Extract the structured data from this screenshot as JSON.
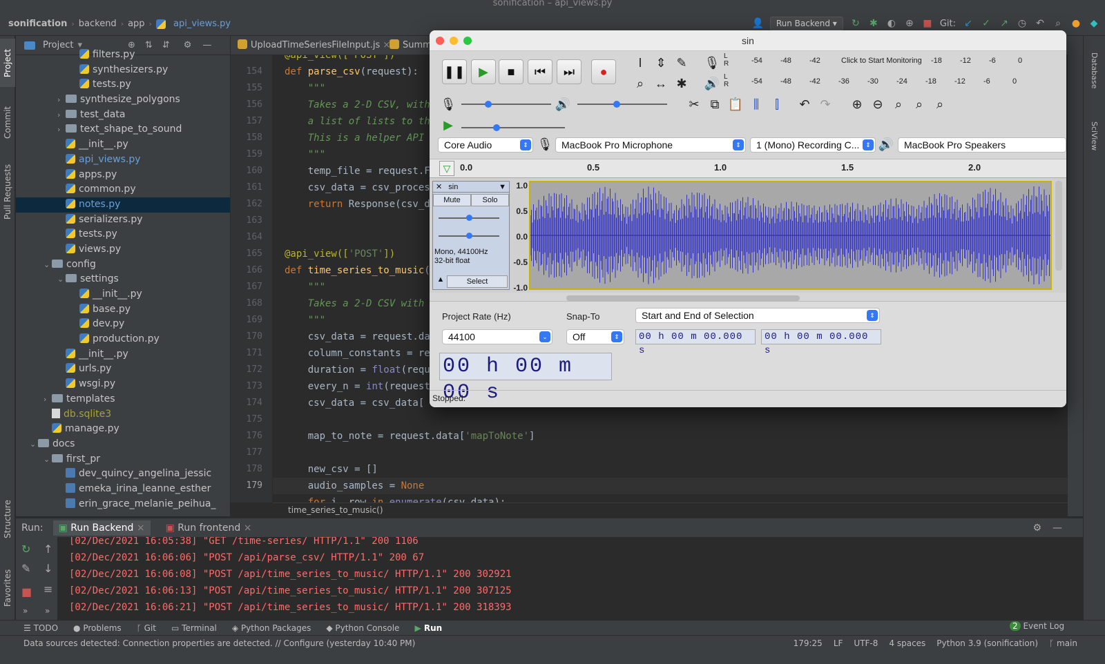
{
  "window_title": "sonification – api_views.py",
  "breadcrumb": {
    "project": "sonification",
    "p1": "backend",
    "p2": "app",
    "file": "api_views.py"
  },
  "toolbar": {
    "run_config": "Run Backend",
    "git_label": "Git:"
  },
  "left_tabs": {
    "project": "Project",
    "commit": "Commit",
    "pull_requests": "Pull Requests",
    "structure": "Structure",
    "favorites": "Favorites"
  },
  "right_tabs": {
    "database": "Database",
    "sciview": "SciView"
  },
  "project_panel": {
    "title": "Project",
    "rows": [
      {
        "indent": 4,
        "type": "py",
        "label": "filters.py"
      },
      {
        "indent": 4,
        "type": "py",
        "label": "synthesizers.py"
      },
      {
        "indent": 4,
        "type": "py",
        "label": "tests.py"
      },
      {
        "indent": 3,
        "type": "folder",
        "arrow": "›",
        "label": "synthesize_polygons"
      },
      {
        "indent": 3,
        "type": "folder",
        "arrow": "›",
        "label": "test_data"
      },
      {
        "indent": 3,
        "type": "folder",
        "arrow": "›",
        "label": "text_shape_to_sound"
      },
      {
        "indent": 3,
        "type": "py",
        "label": "__init__.py"
      },
      {
        "indent": 3,
        "type": "py",
        "label": "api_views.py",
        "color": "#6a9fd8"
      },
      {
        "indent": 3,
        "type": "py",
        "label": "apps.py"
      },
      {
        "indent": 3,
        "type": "py",
        "label": "common.py"
      },
      {
        "indent": 3,
        "type": "py",
        "label": "notes.py",
        "color": "#6a9fd8",
        "selected": true
      },
      {
        "indent": 3,
        "type": "py",
        "label": "serializers.py"
      },
      {
        "indent": 3,
        "type": "py",
        "label": "tests.py"
      },
      {
        "indent": 3,
        "type": "py",
        "label": "views.py"
      },
      {
        "indent": 2,
        "type": "folder",
        "arrow": "⌄",
        "label": "config"
      },
      {
        "indent": 3,
        "type": "folder",
        "arrow": "⌄",
        "label": "settings"
      },
      {
        "indent": 4,
        "type": "py",
        "label": "__init__.py"
      },
      {
        "indent": 4,
        "type": "py",
        "label": "base.py"
      },
      {
        "indent": 4,
        "type": "py",
        "label": "dev.py"
      },
      {
        "indent": 4,
        "type": "py",
        "label": "production.py"
      },
      {
        "indent": 3,
        "type": "py",
        "label": "__init__.py"
      },
      {
        "indent": 3,
        "type": "py",
        "label": "urls.py"
      },
      {
        "indent": 3,
        "type": "py",
        "label": "wsgi.py"
      },
      {
        "indent": 2,
        "type": "folder",
        "arrow": "›",
        "label": "templates"
      },
      {
        "indent": 2,
        "type": "db",
        "label": "db.sqlite3",
        "color": "#a5a23a"
      },
      {
        "indent": 2,
        "type": "py",
        "label": "manage.py"
      },
      {
        "indent": 1,
        "type": "folder",
        "arrow": "⌄",
        "label": "docs"
      },
      {
        "indent": 2,
        "type": "folder",
        "arrow": "⌄",
        "label": "first_pr"
      },
      {
        "indent": 3,
        "type": "md",
        "label": "dev_quincy_angelina_jessic"
      },
      {
        "indent": 3,
        "type": "md",
        "label": "emeka_irina_leanne_esther"
      },
      {
        "indent": 3,
        "type": "md",
        "label": "erin_grace_melanie_peihua_"
      }
    ]
  },
  "editor": {
    "tabs": [
      "UploadTimeSeriesFileInput.js",
      "Summ"
    ],
    "line_numbers": [
      "",
      "154",
      "155",
      "156",
      "157",
      "158",
      "159",
      "160",
      "161",
      "162",
      "163",
      "164",
      "165",
      "166",
      "167",
      "168",
      "169",
      "170",
      "171",
      "172",
      "173",
      "174",
      "175",
      "176",
      "177",
      "178",
      "179",
      ""
    ],
    "current_line": "179",
    "code_lines": [
      [
        [
          "dec",
          "@api_view(['POST'])"
        ]
      ],
      [
        [
          "kw",
          "def "
        ],
        [
          "fn",
          "parse_csv"
        ],
        [
          "",
          "(request):"
        ]
      ],
      [
        [
          "doc",
          "    \"\"\""
        ]
      ],
      [
        [
          "doc",
          "    Takes a 2-D CSV, with"
        ]
      ],
      [
        [
          "doc",
          "    a list of lists to th"
        ]
      ],
      [
        [
          "doc",
          "    This is a helper API"
        ]
      ],
      [
        [
          "doc",
          "    \"\"\""
        ]
      ],
      [
        [
          "",
          "    temp_file = request.F"
        ]
      ],
      [
        [
          "",
          "    csv_data = csv_proces"
        ]
      ],
      [
        [
          "kw",
          "    return "
        ],
        [
          "",
          "Response(csv_d"
        ]
      ],
      [
        [
          "",
          ""
        ]
      ],
      [
        [
          "",
          ""
        ]
      ],
      [
        [
          "dec",
          "@api_view(["
        ],
        [
          "str",
          "'POST'"
        ],
        [
          "dec",
          "])"
        ]
      ],
      [
        [
          "kw",
          "def "
        ],
        [
          "fn",
          "time_series_to_music"
        ],
        [
          "",
          "("
        ]
      ],
      [
        [
          "doc",
          "    \"\"\""
        ]
      ],
      [
        [
          "doc",
          "    Takes a 2-D CSV with"
        ]
      ],
      [
        [
          "doc",
          "    \"\"\""
        ]
      ],
      [
        [
          "",
          "    csv_data = request.da"
        ]
      ],
      [
        [
          "",
          "    column_constants = re"
        ]
      ],
      [
        [
          "",
          "    duration = "
        ],
        [
          "bi",
          "float"
        ],
        [
          "",
          "(requ"
        ]
      ],
      [
        [
          "",
          "    every_n = "
        ],
        [
          "bi",
          "int"
        ],
        [
          "",
          "(request"
        ]
      ],
      [
        [
          "",
          "    csv_data = csv_data["
        ]
      ],
      [
        [
          "",
          ""
        ]
      ],
      [
        [
          "",
          "    map_to_note = request.data["
        ],
        [
          "str",
          "'mapToNote'"
        ],
        [
          "",
          "]"
        ]
      ],
      [
        [
          "",
          ""
        ]
      ],
      [
        [
          "",
          "    new_csv = []"
        ]
      ],
      [
        [
          "",
          "    audio_samples = "
        ],
        [
          "kw",
          "None"
        ]
      ],
      [
        [
          "kw",
          "    for "
        ],
        [
          "",
          "i, row "
        ],
        [
          "kw",
          "in "
        ],
        [
          "bi",
          "enumerate"
        ],
        [
          "",
          "(csv_data):"
        ]
      ]
    ],
    "bottom_breadcrumb": "time_series_to_music()"
  },
  "run_panel": {
    "label": "Run:",
    "tabs": [
      "Run Backend",
      "Run frontend"
    ],
    "log": [
      "[02/Dec/2021 16:05:38] \"GET /time-series/ HTTP/1.1\" 200 1106",
      "[02/Dec/2021 16:06:06] \"POST /api/parse_csv/ HTTP/1.1\" 200 67",
      "[02/Dec/2021 16:06:08] \"POST /api/time_series_to_music/ HTTP/1.1\" 200 302921",
      "[02/Dec/2021 16:06:13] \"POST /api/time_series_to_music/ HTTP/1.1\" 200 307125",
      "[02/Dec/2021 16:06:21] \"POST /api/time_series_to_music/ HTTP/1.1\" 200 318393"
    ]
  },
  "bottom_tabs": [
    "TODO",
    "Problems",
    "Git",
    "Terminal",
    "Python Packages",
    "Python Console",
    "Run"
  ],
  "event_log": {
    "count": "2",
    "label": "Event Log"
  },
  "status": {
    "message": "Data sources detected: Connection properties are detected. // Configure (yesterday 10:40 PM)",
    "position": "179:25",
    "line_sep": "LF",
    "encoding": "UTF-8",
    "indent": "4 spaces",
    "interpreter": "Python 3.9 (sonification)",
    "branch": "main"
  },
  "audacity": {
    "title": "sin",
    "meter_top_ticks": [
      "-54",
      "-48",
      "-42",
      "Click to Start Monitoring",
      "-18",
      "-12",
      "-6",
      "0"
    ],
    "meter_bottom_ticks": [
      "-54",
      "-48",
      "-42",
      "-36",
      "-30",
      "-24",
      "-18",
      "-12",
      "-6",
      "0"
    ],
    "host": "Core Audio",
    "input_device": "MacBook Pro Microphone",
    "channels": "1 (Mono) Recording C...",
    "output_device": "MacBook Pro Speakers",
    "ruler_ticks": [
      "0.0",
      "0.5",
      "1.0",
      "1.5",
      "2.0"
    ],
    "track": {
      "name": "sin",
      "mute": "Mute",
      "solo": "Solo",
      "info1": "Mono, 44100Hz",
      "info2": "32-bit float",
      "select": "Select",
      "y_ticks": [
        "1.0",
        "0.5",
        "0.0",
        "-0.5",
        "-1.0"
      ]
    },
    "project_rate_label": "Project Rate (Hz)",
    "project_rate": "44100",
    "snap_to_label": "Snap-To",
    "snap_to": "Off",
    "selection_mode": "Start and End of Selection",
    "sel_start": "00 h 00 m 00.000 s",
    "sel_end": "00 h 00 m 00.000 s",
    "big_time": "00 h 00 m 00 s",
    "status": "Stopped.",
    "colors": {
      "waveform": "#3232c8",
      "track_bg": "#a8a8a8",
      "selection_border": "#c8b400"
    }
  }
}
